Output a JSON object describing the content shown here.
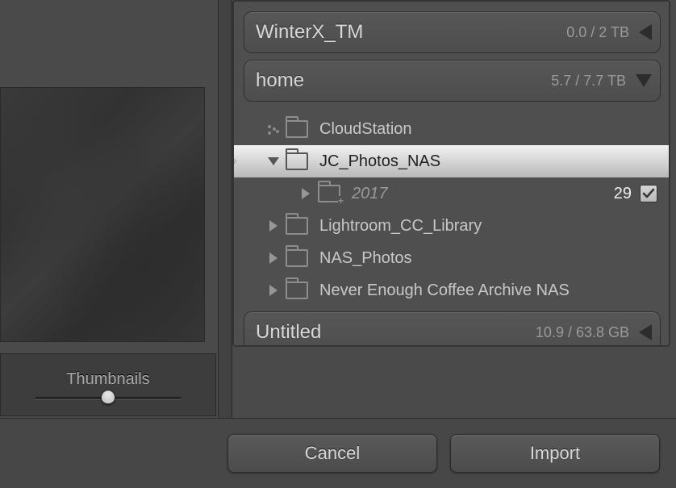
{
  "thumbnails_label": "Thumbnails",
  "volumes": [
    {
      "name": "WinterX_TM",
      "capacity": "0.0 / 2 TB",
      "expanded": false
    },
    {
      "name": "home",
      "capacity": "5.7 / 7.7 TB",
      "expanded": true
    },
    {
      "name": "Untitled",
      "capacity": "10.9 / 63.8 GB",
      "expanded": false
    }
  ],
  "tree": {
    "items": [
      {
        "label": "CloudStation",
        "disclose": "dots",
        "selected": false
      },
      {
        "label": "JC_Photos_NAS",
        "disclose": "down",
        "selected": true
      },
      {
        "label": "2017",
        "disclose": "right",
        "indent": 1,
        "italic": true,
        "add": true,
        "count": "29",
        "checked": true
      },
      {
        "label": "Lightroom_CC_Library",
        "disclose": "right"
      },
      {
        "label": "NAS_Photos",
        "disclose": "right"
      },
      {
        "label": "Never Enough Coffee Archive NAS",
        "disclose": "right"
      }
    ]
  },
  "buttons": {
    "cancel": "Cancel",
    "import": "Import"
  }
}
